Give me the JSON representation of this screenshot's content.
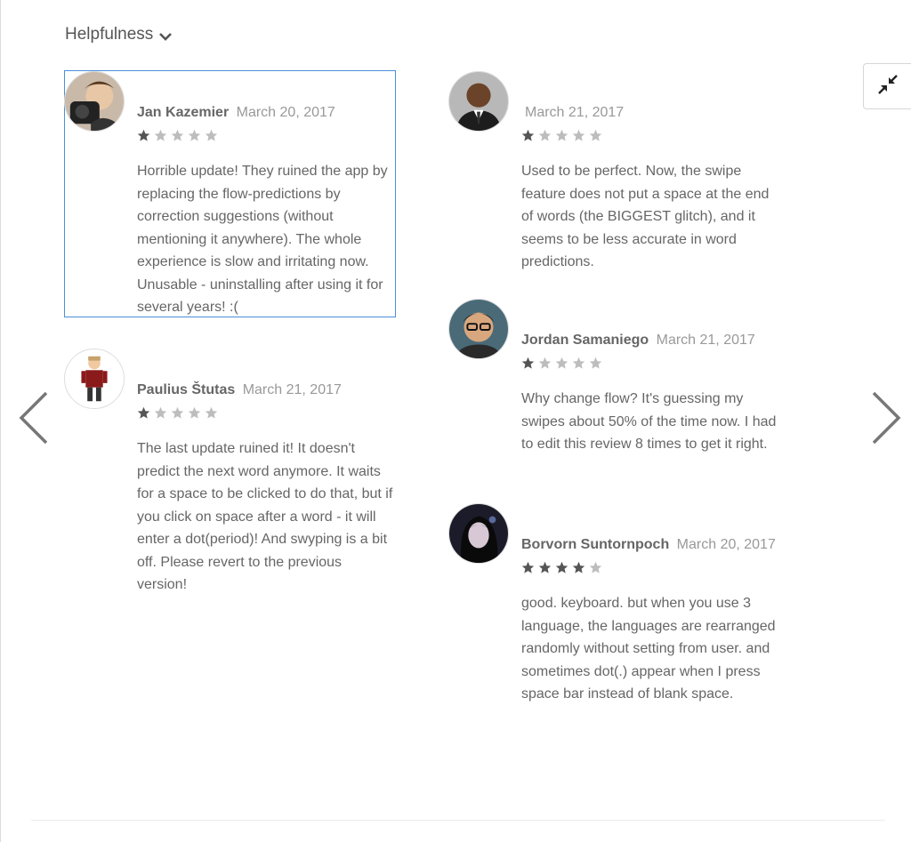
{
  "sort": {
    "label": "Helpfulness",
    "icon": "chevron-down-icon"
  },
  "controls": {
    "collapse_icon": "collapse-icon",
    "prev_icon": "chevron-left-icon",
    "next_icon": "chevron-right-icon"
  },
  "colors": {
    "star_filled": "#555555",
    "star_empty": "#bdbdbd",
    "focus_border": "#4a90d9",
    "text": "#666666",
    "date": "#999999"
  },
  "reviews": [
    {
      "author": "Jan Kazemier",
      "date": "March 20, 2017",
      "rating": 1,
      "text": "Horrible update! They ruined the app by replacing the flow-predictions by correction suggestions (without mentioning it anywhere). The whole experience is slow and irritating now. Unusable - uninstalling after using it for several years! :("
    },
    {
      "author": "Paulius Štutas",
      "date": "March 21, 2017",
      "rating": 1,
      "text": "The last update ruined it! It doesn't predict the next word anymore. It waits for a space to be clicked to do that, but if you click on space after a word - it will enter a dot(period)! And swyping is a bit off. Please revert to the previous version!"
    },
    {
      "author": "",
      "date": "March 21, 2017",
      "rating": 1,
      "text": "Used to be perfect. Now, the swipe feature does not put a space at the end of words (the BIGGEST glitch), and it seems to be less accurate in word predictions."
    },
    {
      "author": "Jordan Samaniego",
      "date": "March 21, 2017",
      "rating": 1,
      "text": "Why change flow? It's guessing my swipes about 50% of the time now. I had to edit this review 8 times to get it right."
    },
    {
      "author": "Borvorn Suntornpoch",
      "date": "March 20, 2017",
      "rating": 4,
      "text": "good. keyboard. but when you use 3 language, the languages are rearranged randomly without setting from user. and sometimes dot(.) appear when I press space bar instead of blank space."
    }
  ]
}
